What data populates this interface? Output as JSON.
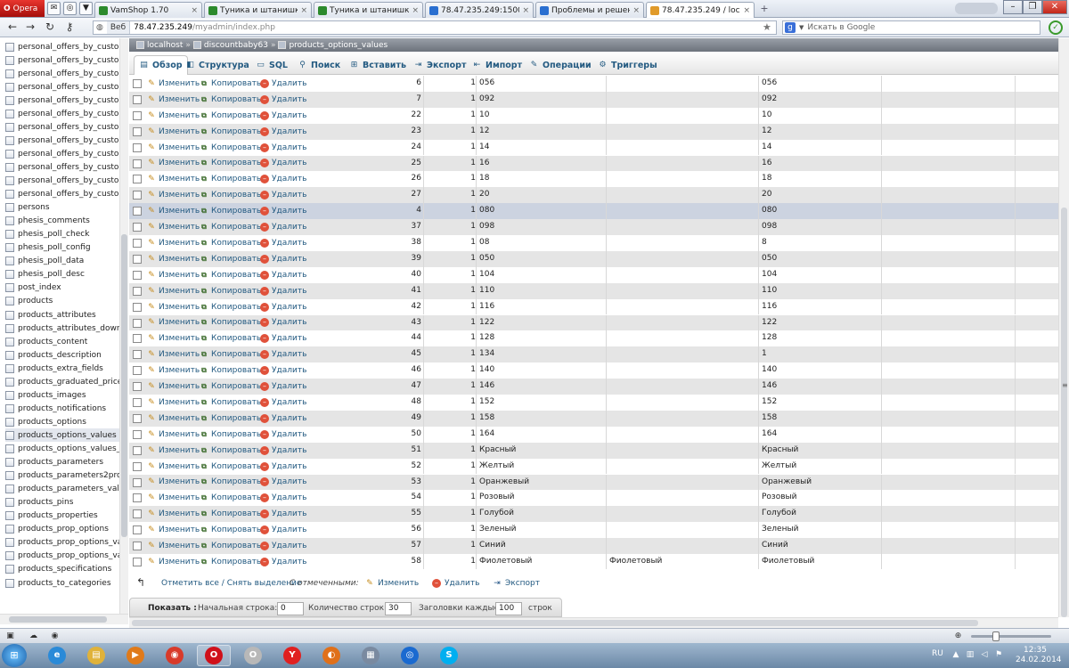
{
  "browser": {
    "menu_label": "Opera",
    "tabs": [
      {
        "label": "VamShop 1.70",
        "color": "#2c8a2c",
        "active": false
      },
      {
        "label": "Туника и штанишки 2...",
        "color": "#2c8a2c",
        "active": false
      },
      {
        "label": "Туника и штанишки - ...",
        "color": "#2c8a2c",
        "active": false
      },
      {
        "label": "78.47.235.249:1500 :: IS...",
        "color": "#2a6fd0",
        "active": false
      },
      {
        "label": "Проблемы и решени...",
        "color": "#2a6fd0",
        "active": false
      },
      {
        "label": "78.47.235.249 / localho...",
        "color": "#e09a2a",
        "active": true
      }
    ],
    "address": {
      "badge": "Веб",
      "host": "78.47.235.249",
      "path": "/myadmin/index.php"
    },
    "search_placeholder": "Искать в Google",
    "search_engine": "g",
    "close_symbol": "×",
    "new_tab_symbol": "+",
    "window_controls": [
      "–",
      "❐",
      "✕"
    ]
  },
  "left_nav": {
    "items": [
      "personal_offers_by_custo",
      "personal_offers_by_custo",
      "personal_offers_by_custo",
      "personal_offers_by_custo",
      "personal_offers_by_custo",
      "personal_offers_by_custo",
      "personal_offers_by_custo",
      "personal_offers_by_custo",
      "personal_offers_by_custo",
      "personal_offers_by_custo",
      "personal_offers_by_custo",
      "personal_offers_by_custo",
      "persons",
      "phesis_comments",
      "phesis_poll_check",
      "phesis_poll_config",
      "phesis_poll_data",
      "phesis_poll_desc",
      "post_index",
      "products",
      "products_attributes",
      "products_attributes_downl",
      "products_content",
      "products_description",
      "products_extra_fields",
      "products_graduated_price",
      "products_images",
      "products_notifications",
      "products_options",
      "products_options_values",
      "products_options_values_t",
      "products_parameters",
      "products_parameters2proc",
      "products_parameters_valu",
      "products_pins",
      "products_properties",
      "products_prop_options",
      "products_prop_options_va",
      "products_prop_options_va",
      "products_specifications",
      "products_to_categories"
    ],
    "selected_index": 29
  },
  "breadcrumb": {
    "server": "localhost",
    "db": "discountbaby63",
    "table": "products_options_values",
    "separator": "»"
  },
  "menu": {
    "tabs": [
      {
        "label": "Обзор",
        "icon": "▤",
        "active": true
      },
      {
        "label": "Структура",
        "icon": "◧",
        "active": false
      },
      {
        "label": "SQL",
        "icon": "▭",
        "active": false
      },
      {
        "label": "Поиск",
        "icon": "⚲",
        "active": false
      },
      {
        "label": "Вставить",
        "icon": "⊞",
        "active": false
      },
      {
        "label": "Экспорт",
        "icon": "⇥",
        "active": false
      },
      {
        "label": "Импорт",
        "icon": "⇤",
        "active": false
      },
      {
        "label": "Операции",
        "icon": "✎",
        "active": false
      },
      {
        "label": "Триггеры",
        "icon": "⚙",
        "active": false
      }
    ]
  },
  "row_actions": {
    "edit": "Изменить",
    "copy": "Копировать",
    "delete": "Удалить"
  },
  "rows": [
    {
      "id": "6",
      "lang": "1",
      "name": "056",
      "extra": "",
      "value": "056"
    },
    {
      "id": "7",
      "lang": "1",
      "name": "092",
      "extra": "",
      "value": "092"
    },
    {
      "id": "22",
      "lang": "1",
      "name": "10",
      "extra": "",
      "value": "10"
    },
    {
      "id": "23",
      "lang": "1",
      "name": "12",
      "extra": "",
      "value": "12"
    },
    {
      "id": "24",
      "lang": "1",
      "name": "14",
      "extra": "",
      "value": "14"
    },
    {
      "id": "25",
      "lang": "1",
      "name": "16",
      "extra": "",
      "value": "16"
    },
    {
      "id": "26",
      "lang": "1",
      "name": "18",
      "extra": "",
      "value": "18"
    },
    {
      "id": "27",
      "lang": "1",
      "name": "20",
      "extra": "",
      "value": "20"
    },
    {
      "id": "4",
      "lang": "1",
      "name": "080",
      "extra": "",
      "value": "080"
    },
    {
      "id": "37",
      "lang": "1",
      "name": "098",
      "extra": "",
      "value": "098"
    },
    {
      "id": "38",
      "lang": "1",
      "name": "08",
      "extra": "",
      "value": "8"
    },
    {
      "id": "39",
      "lang": "1",
      "name": "050",
      "extra": "",
      "value": "050"
    },
    {
      "id": "40",
      "lang": "1",
      "name": "104",
      "extra": "",
      "value": "104"
    },
    {
      "id": "41",
      "lang": "1",
      "name": "110",
      "extra": "",
      "value": "110"
    },
    {
      "id": "42",
      "lang": "1",
      "name": "116",
      "extra": "",
      "value": "116"
    },
    {
      "id": "43",
      "lang": "1",
      "name": "122",
      "extra": "",
      "value": "122"
    },
    {
      "id": "44",
      "lang": "1",
      "name": "128",
      "extra": "",
      "value": "128"
    },
    {
      "id": "45",
      "lang": "1",
      "name": "134",
      "extra": "",
      "value": "1"
    },
    {
      "id": "46",
      "lang": "1",
      "name": "140",
      "extra": "",
      "value": "140"
    },
    {
      "id": "47",
      "lang": "1",
      "name": "146",
      "extra": "",
      "value": "146"
    },
    {
      "id": "48",
      "lang": "1",
      "name": "152",
      "extra": "",
      "value": "152"
    },
    {
      "id": "49",
      "lang": "1",
      "name": "158",
      "extra": "",
      "value": "158"
    },
    {
      "id": "50",
      "lang": "1",
      "name": "164",
      "extra": "",
      "value": "164"
    },
    {
      "id": "51",
      "lang": "1",
      "name": "Красный",
      "extra": "",
      "value": "Красный"
    },
    {
      "id": "52",
      "lang": "1",
      "name": "Желтый",
      "extra": "",
      "value": "Желтый"
    },
    {
      "id": "53",
      "lang": "1",
      "name": "Оранжевый",
      "extra": "",
      "value": "Оранжевый"
    },
    {
      "id": "54",
      "lang": "1",
      "name": "Розовый",
      "extra": "",
      "value": "Розовый"
    },
    {
      "id": "55",
      "lang": "1",
      "name": "Голубой",
      "extra": "",
      "value": "Голубой"
    },
    {
      "id": "56",
      "lang": "1",
      "name": "Зеленый",
      "extra": "",
      "value": "Зеленый"
    },
    {
      "id": "57",
      "lang": "1",
      "name": "Синий",
      "extra": "",
      "value": "Синий"
    },
    {
      "id": "58",
      "lang": "1",
      "name": "Фиолетовый",
      "extra": "Фиолетовый",
      "value": "Фиолетовый"
    }
  ],
  "highlight_row_index": 8,
  "bottom_actions": {
    "select_all": "Отметить все / Снять выделение",
    "with_selected": "С отмеченными:",
    "edit": "Изменить",
    "delete": "Удалить",
    "export": "Экспорт"
  },
  "show_bar": {
    "label": "Показать :",
    "start_label": "Начальная строка:",
    "start_value": "0",
    "count_label": "Количество строк:",
    "count_value": "30",
    "headers_label": "Заголовки каждые",
    "headers_value": "100",
    "rows_label": "строк"
  },
  "taskbar": {
    "apps": [
      {
        "name": "ie",
        "glyph": "e",
        "color": "#2a8ad8",
        "open": false
      },
      {
        "name": "explorer",
        "glyph": "▤",
        "color": "#e0b23a",
        "open": false
      },
      {
        "name": "media",
        "glyph": "▶",
        "color": "#e07a1a",
        "open": false
      },
      {
        "name": "chrome",
        "glyph": "◉",
        "color": "#d83a2a",
        "open": false
      },
      {
        "name": "opera",
        "glyph": "O",
        "color": "#d0101a",
        "open": true
      },
      {
        "name": "opera-alt",
        "glyph": "O",
        "color": "#b8b8b8",
        "open": false
      },
      {
        "name": "yandex",
        "glyph": "Y",
        "color": "#e02020",
        "open": false
      },
      {
        "name": "firefox",
        "glyph": "◐",
        "color": "#e0701a",
        "open": false
      },
      {
        "name": "calculator",
        "glyph": "▦",
        "color": "#7a8aa0",
        "open": false
      },
      {
        "name": "web-ide",
        "glyph": "◎",
        "color": "#1a6ad0",
        "open": false
      },
      {
        "name": "skype",
        "glyph": "S",
        "color": "#00aff0",
        "open": false
      }
    ],
    "lang": "RU",
    "time": "12:35",
    "date": "24.02.2014"
  }
}
